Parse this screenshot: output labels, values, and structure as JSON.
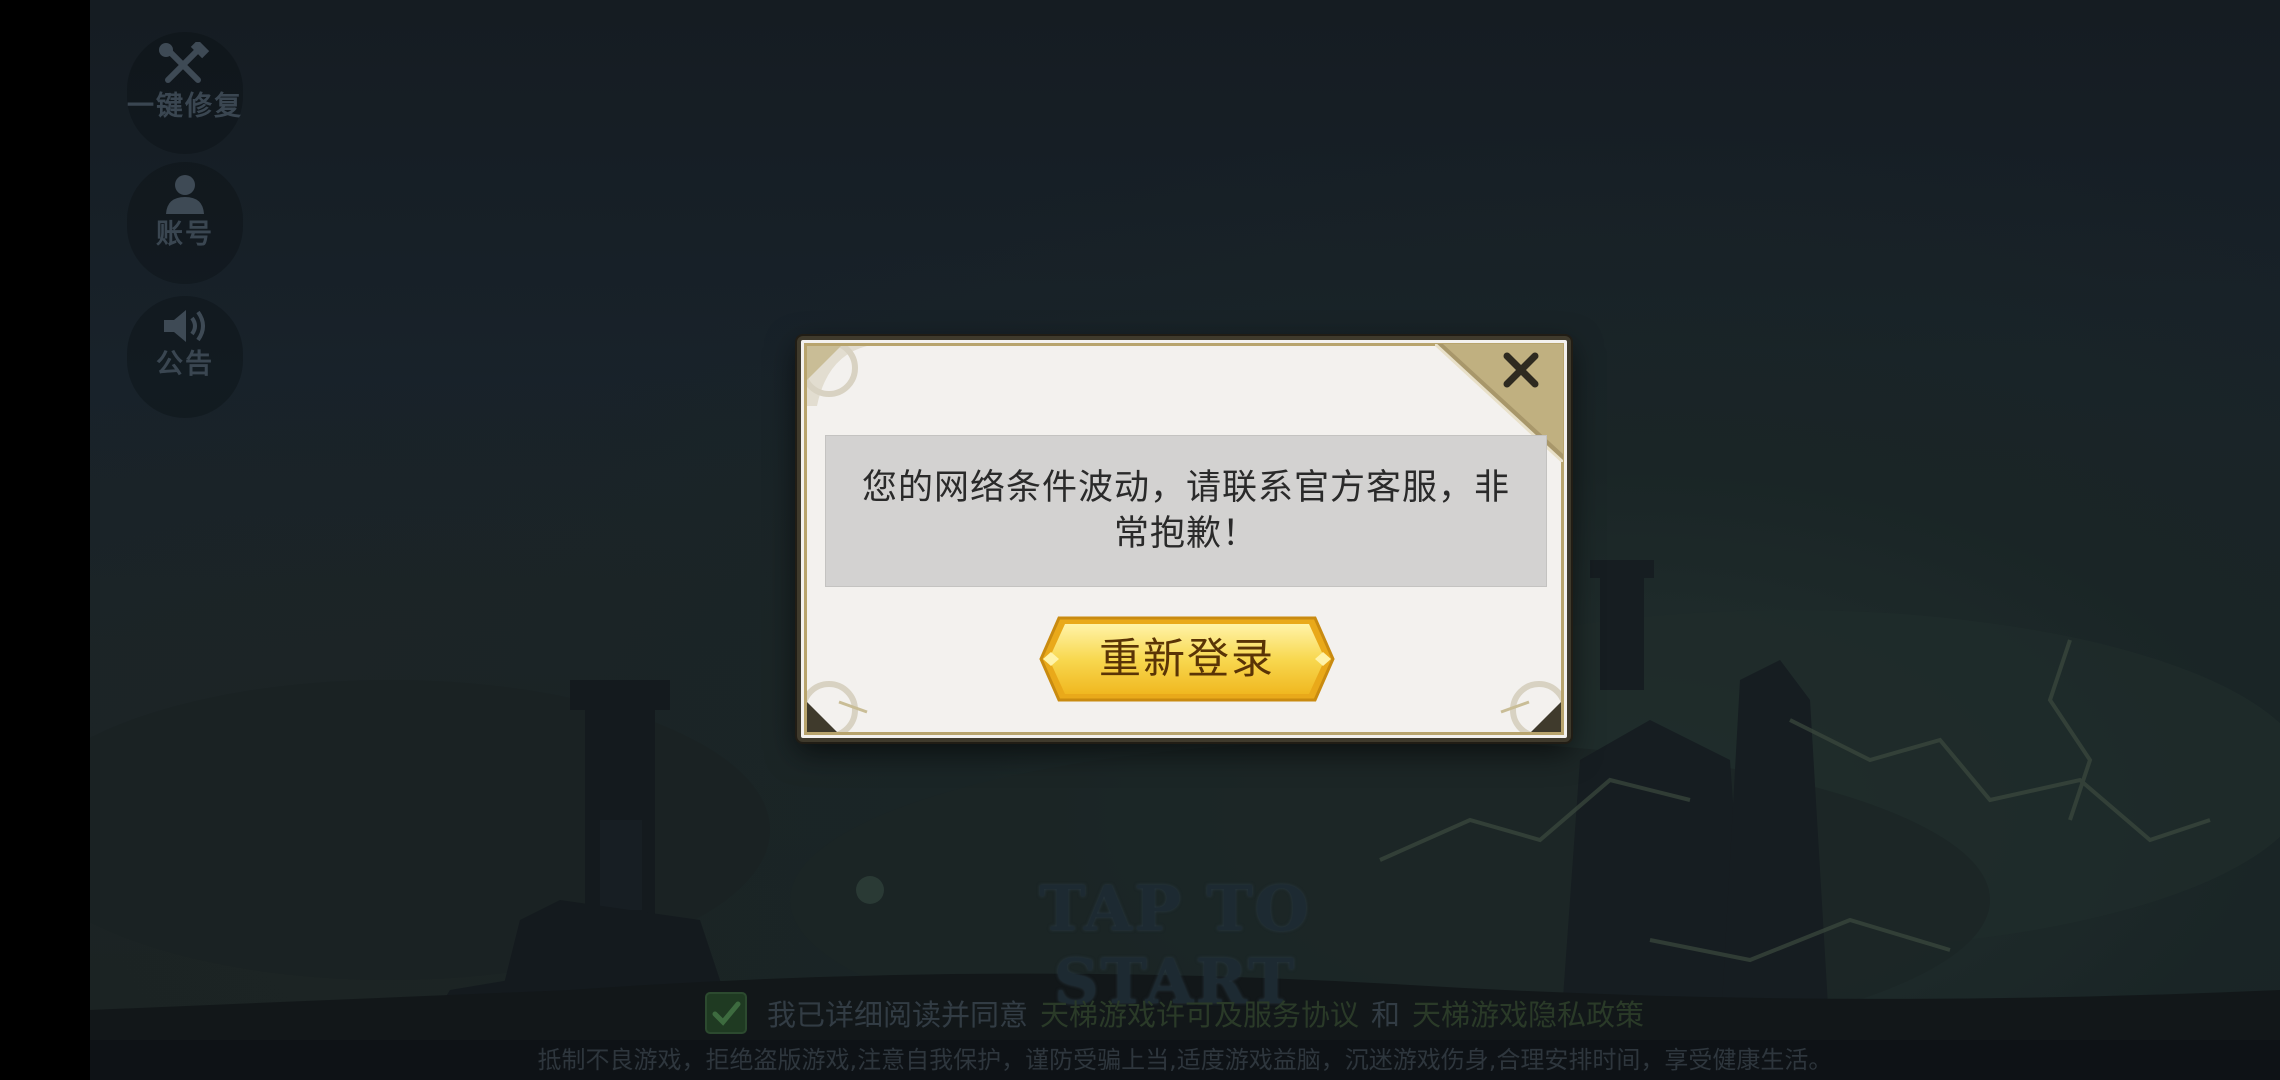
{
  "side_menu": {
    "repair_label": "一键修复",
    "account_label": "账号",
    "notice_label": "公告"
  },
  "modal": {
    "message": "您的网络条件波动，请联系官方客服，非常抱歉！",
    "button_label": "重新登录"
  },
  "start": {
    "label": "TAP TO START"
  },
  "agreement": {
    "prefix": "我已详细阅读并同意",
    "link1": "天梯游戏许可及服务协议",
    "and": "和",
    "link2": "天梯游戏隐私政策",
    "checked": true
  },
  "footer": {
    "text": "抵制不良游戏，拒绝盗版游戏,注意自我保护，谨防受骗上当,适度游戏益脑，沉迷游戏伤身,合理安排时间，享受健康生活。"
  },
  "colors": {
    "button_gold": "#f6d55a",
    "modal_bg": "#f3f1ee",
    "message_bg": "#d3d2d1",
    "frame_gold": "#b8a46d"
  }
}
